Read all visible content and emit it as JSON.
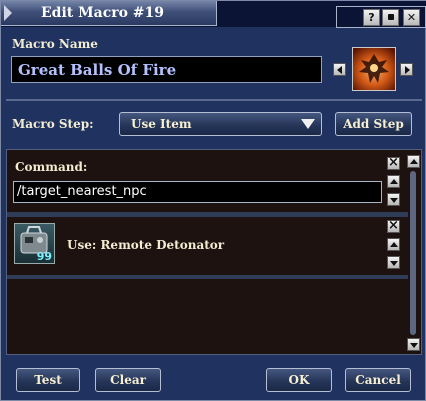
{
  "window": {
    "title": "Edit Macro #19",
    "title_buttons": [
      "?",
      "■",
      "✕"
    ]
  },
  "macro_name": {
    "label": "Macro Name",
    "value": "Great Balls Of Fire",
    "icon": "fireball-icon"
  },
  "macro_step": {
    "label": "Macro Step:",
    "selected": "Use Item",
    "add_step": "Add Step"
  },
  "steps": [
    {
      "header": "Command:",
      "value": "/target_nearest_npc"
    },
    {
      "label": "Use: Remote Detonator",
      "icon": "remote-detonator-icon",
      "count": "99"
    }
  ],
  "footer": {
    "test": "Test",
    "clear": "Clear",
    "ok": "OK",
    "cancel": "Cancel"
  },
  "colors": {
    "window_bg": "#1f3260",
    "panel_bg": "#1e1210",
    "name_text": "#b3c2ff",
    "label_text": "#f2ecd0"
  }
}
